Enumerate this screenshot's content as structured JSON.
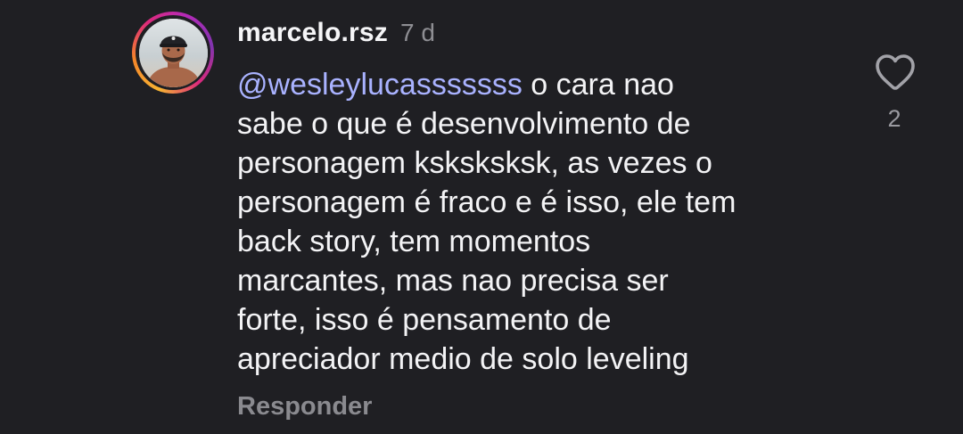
{
  "comment": {
    "username": "marcelo.rsz",
    "time": "7 d",
    "mention": "@wesleylucasssssss",
    "lines": {
      "l1_rest": " o cara nao",
      "l2": "sabe o que é desenvolvimento de",
      "l3": "personagem ksksksksk, as vezes o",
      "l4": "personagem é fraco e é isso, ele tem",
      "l5": "back story, tem momentos",
      "l6": "marcantes, mas nao precisa ser",
      "l7": "forte, isso é pensamento de",
      "l8": "apreciador medio de solo leveling"
    },
    "reply_label": "Responder",
    "like_count": "2",
    "like_icon": "heart-outline-icon"
  },
  "colors": {
    "background": "#1f1f23",
    "text": "#f3f3f5",
    "mention": "#a9b2ff",
    "muted": "#8a8a8f"
  }
}
